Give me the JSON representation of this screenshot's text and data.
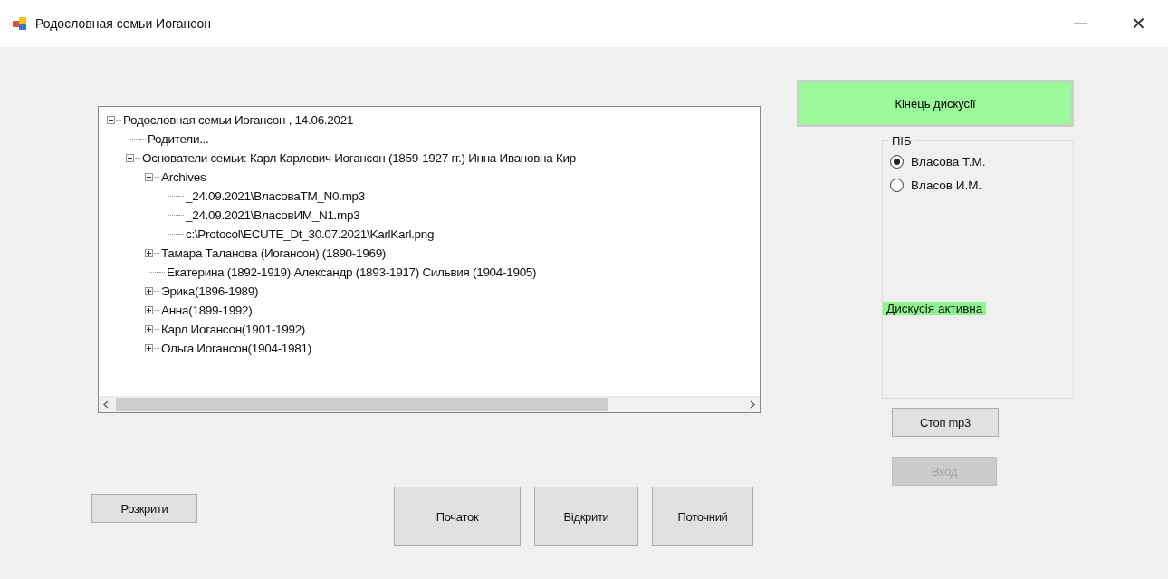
{
  "window": {
    "title": "Родословная семьи Иогансон",
    "close": "✕"
  },
  "tree": {
    "nodes": [
      {
        "label": "Родословная семьи Иогансон  , 14.06.2021",
        "kind": "folder",
        "expanded": true,
        "children": [
          {
            "label": "Родители...",
            "kind": "leaf"
          },
          {
            "label": "Основатели семьи: Карл Карлович Иогансон (1859-1927 гг.) Инна Ивановна Кир",
            "kind": "folder",
            "expanded": true,
            "children": [
              {
                "label": "Archives",
                "kind": "folder",
                "expanded": true,
                "children": [
                  {
                    "label": "_24.09.2021\\ВласоваТМ_N0.mp3",
                    "kind": "leaf"
                  },
                  {
                    "label": "_24.09.2021\\ВласовИМ_N1.mp3",
                    "kind": "leaf"
                  },
                  {
                    "label": "c:\\Protocol\\ECUTE_Dt_30.07.2021\\KarlKarl.png",
                    "kind": "leaf"
                  }
                ]
              },
              {
                "label": "Тамара Таланова (Иогансон) (1890-1969)",
                "kind": "folder",
                "expanded": false
              },
              {
                "label": "Екатерина (1892-1919) Александр (1893-1917) Сильвия (1904-1905)",
                "kind": "leaf"
              },
              {
                "label": "Эрика(1896-1989)",
                "kind": "folder",
                "expanded": false
              },
              {
                "label": "Анна(1899-1992)",
                "kind": "folder",
                "expanded": false
              },
              {
                "label": "Карл Иогансон(1901-1992)",
                "kind": "folder",
                "expanded": false
              },
              {
                "label": "Ольга Иогансон(1904-1981)",
                "kind": "folder",
                "expanded": false
              }
            ]
          }
        ]
      }
    ]
  },
  "end_button": "Кінець дискусії",
  "group": {
    "title": "ПІБ",
    "options": [
      {
        "label": "Власова Т.М.",
        "selected": true
      },
      {
        "label": "Власов И.М.",
        "selected": false
      }
    ],
    "status": "Дискусія активна"
  },
  "stop_button": "Стоп mp3",
  "exit_button": {
    "label": "Вход",
    "disabled": true
  },
  "expand_button": "Розкрити",
  "buttons": [
    "Початок",
    "Відкрити",
    "Поточний"
  ]
}
